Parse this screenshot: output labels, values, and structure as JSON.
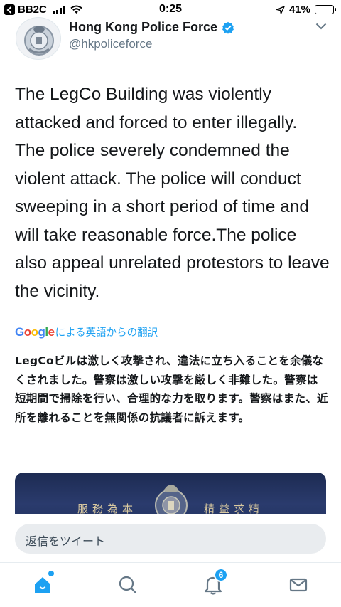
{
  "status_bar": {
    "carrier": "BB2C",
    "time": "0:25",
    "battery": "41%",
    "battery_level": 0.41
  },
  "tweet": {
    "author_name": "Hong Kong Police Force",
    "author_handle": "@hkpoliceforce",
    "text": "The LegCo Building was violently attacked and forced to enter illegally. The police severely condemned the violent attack. The police will conduct sweeping in a short period of time and will take reasonable force.The police also appeal unrelated protestors to leave the vicinity.",
    "translation_provider": "Google",
    "translation_label": "による英語からの翻訳",
    "translated_text": "LegCoビルは激しく攻撃され、違法に立ち入ることを余儀なくされました。警察は激しい攻撃を厳しく非難した。警察は短期間で掃除を行い、合理的な力を取ります。警察はまた、近所を離れることを無関係の抗議者に訴えます。",
    "media": {
      "plaque_left": "服務為本",
      "plaque_right": "精益求精"
    }
  },
  "reply": {
    "placeholder": "返信をツイート"
  },
  "tabbar": {
    "notifications_badge": "6",
    "icons": [
      "home-icon",
      "search-icon",
      "notifications-icon",
      "messages-icon"
    ]
  },
  "colors": {
    "accent": "#1da1f2",
    "text": "#14171a",
    "secondary": "#657786"
  }
}
